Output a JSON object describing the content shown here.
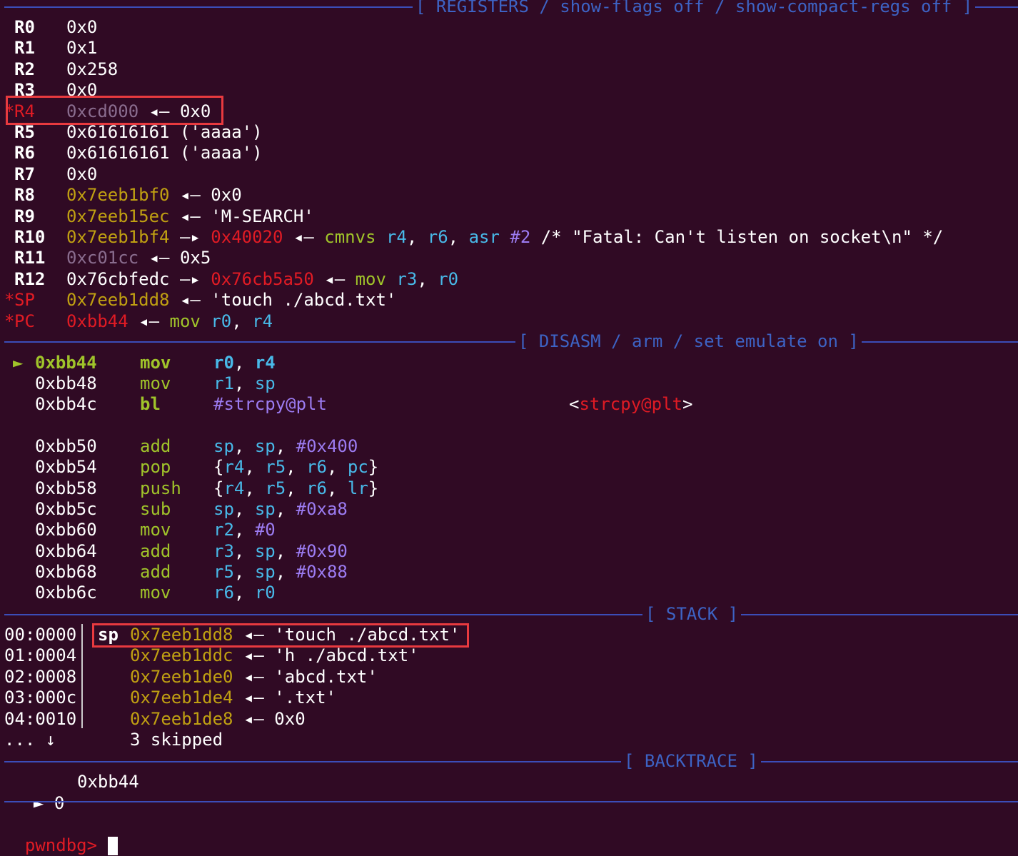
{
  "registers": {
    "header": "[ REGISTERS / show-flags off / show-compact-regs off ]",
    "rows": [
      {
        "mark": "",
        "name": "R0",
        "value": "0x0",
        "deref": ""
      },
      {
        "mark": "",
        "name": "R1",
        "value": "0x1",
        "deref": ""
      },
      {
        "mark": "",
        "name": "R2",
        "value": "0x258",
        "deref": ""
      },
      {
        "mark": "",
        "name": "R3",
        "value": "0x0",
        "deref": ""
      },
      {
        "mark": "*",
        "name": "R4",
        "value": "0xcd000",
        "deref": " ◂— 0x0"
      },
      {
        "mark": "",
        "name": "R5",
        "value": "0x61616161 ('aaaa')",
        "deref": ""
      },
      {
        "mark": "",
        "name": "R6",
        "value": "0x61616161 ('aaaa')",
        "deref": ""
      },
      {
        "mark": "",
        "name": "R7",
        "value": "0x0",
        "deref": ""
      },
      {
        "mark": "",
        "name": "R8",
        "value": "0x7eeb1bf0",
        "deref": " ◂— 0x0"
      },
      {
        "mark": "",
        "name": "R9",
        "value": "0x7eeb15ec",
        "deref": " ◂— 'M-SEARCH'"
      },
      {
        "mark": "",
        "name": "R10",
        "value": "0x7eeb1bf4",
        "arrow": " —▸ ",
        "target": "0x40020",
        "back": " ◂— ",
        "ins": "cmnvs",
        "ops": [
          {
            "t": "r4",
            "c": "c-cyan"
          },
          {
            "t": ", ",
            "c": "c-white"
          },
          {
            "t": "r6",
            "c": "c-cyan"
          },
          {
            "t": ", ",
            "c": "c-white"
          },
          {
            "t": "asr ",
            "c": "c-cyan"
          },
          {
            "t": "#2",
            "c": "c-vio"
          }
        ],
        "comment": " /* \"Fatal: Can't listen on socket\\n\" */"
      },
      {
        "mark": "",
        "name": "R11",
        "value": "0xc01cc",
        "deref": " ◂— 0x5"
      },
      {
        "mark": "",
        "name": "R12",
        "value": "0x76cbfedc",
        "arrow": " —▸ ",
        "target": "0x76cb5a50",
        "back": " ◂— ",
        "ins": "mov",
        "ops": [
          {
            "t": "r3",
            "c": "c-cyan"
          },
          {
            "t": ", ",
            "c": "c-white"
          },
          {
            "t": "r0",
            "c": "c-cyan"
          }
        ],
        "comment": ""
      },
      {
        "mark": "*",
        "name": "SP",
        "value": "0x7eeb1dd8",
        "deref": " ◂— 'touch ./abcd.txt'"
      },
      {
        "mark": "*",
        "name": "PC",
        "value": "0xbb44",
        "back": " ◂— ",
        "ins": "mov",
        "ops": [
          {
            "t": "r0",
            "c": "c-cyan"
          },
          {
            "t": ", ",
            "c": "c-white"
          },
          {
            "t": "r4",
            "c": "c-cyan"
          }
        ]
      }
    ]
  },
  "disasm": {
    "header": "[ DISASM / arm / set emulate on ]",
    "current_marker": "►",
    "rows": [
      {
        "addr": "0xbb44",
        "mn": "mov",
        "ops": "r0, r4",
        "current": true
      },
      {
        "addr": "0xbb48",
        "mn": "mov",
        "ops": "r1, sp"
      },
      {
        "addr": "0xbb4c",
        "mn": "bl",
        "ops": "#strcpy@plt",
        "call": "strcpy@plt"
      },
      {
        "addr": "0xbb50",
        "mn": "add",
        "ops": "sp, sp, #0x400"
      },
      {
        "addr": "0xbb54",
        "mn": "pop",
        "ops": "{r4, r5, r6, pc}"
      },
      {
        "addr": "0xbb58",
        "mn": "push",
        "ops": "{r4, r5, r6, lr}"
      },
      {
        "addr": "0xbb5c",
        "mn": "sub",
        "ops": "sp, sp, #0xa8"
      },
      {
        "addr": "0xbb60",
        "mn": "mov",
        "ops": "r2, #0"
      },
      {
        "addr": "0xbb64",
        "mn": "add",
        "ops": "r3, sp, #0x90"
      },
      {
        "addr": "0xbb68",
        "mn": "add",
        "ops": "r5, sp, #0x88"
      },
      {
        "addr": "0xbb6c",
        "mn": "mov",
        "ops": "r6, r0"
      }
    ]
  },
  "stack": {
    "header": "[ STACK ]",
    "rows": [
      {
        "offset": "00:0000",
        "label": "sp",
        "addr": "0x7eeb1dd8",
        "deref": " ◂— 'touch ./abcd.txt'"
      },
      {
        "offset": "01:0004",
        "label": "",
        "addr": "0x7eeb1ddc",
        "deref": " ◂— 'h ./abcd.txt'"
      },
      {
        "offset": "02:0008",
        "label": "",
        "addr": "0x7eeb1de0",
        "deref": " ◂— 'abcd.txt'"
      },
      {
        "offset": "03:000c",
        "label": "",
        "addr": "0x7eeb1de4",
        "deref": " ◂— '.txt'"
      },
      {
        "offset": "04:0010",
        "label": "",
        "addr": "0x7eeb1de8",
        "deref": " ◂— 0x0"
      }
    ],
    "skip_offset": "... ↓",
    "skip_text": "3 skipped"
  },
  "backtrace": {
    "header": "[ BACKTRACE ]",
    "marker": "►",
    "index": "0",
    "addr": "0xbb44"
  },
  "prompt": {
    "text": "pwndbg>",
    "input": ""
  },
  "colors": {
    "background": "#300a24",
    "separator": "#3b4db8",
    "highlight_box": "#e83a3f"
  }
}
